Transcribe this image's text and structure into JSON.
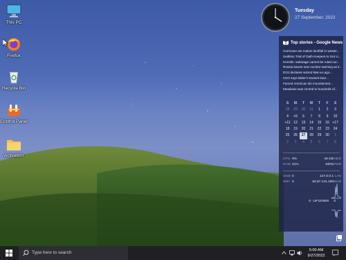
{
  "desktop": {
    "icons": [
      {
        "label": "This PC",
        "icon": "monitor-icon"
      },
      {
        "label": "Firefox",
        "icon": "firefox-icon"
      },
      {
        "label": "Recycle Bin",
        "icon": "recycle-bin-icon"
      },
      {
        "label": "Control Panel",
        "icon": "control-panel-icon"
      },
      {
        "label": "Activation",
        "icon": "folder-icon"
      }
    ]
  },
  "gadget": {
    "day": "Tuesday",
    "date": "27 September, 2022",
    "news_title": "Top stories - Google News",
    "news": [
      "Hurricane Ian makes landfall in wester...",
      "Sedition Trial of Oath Keepers to Get U...",
      "Kremlin: sabotage cannot be ruled out...",
      "Russia issues new nuclear warning as it...",
      "DOJ declares seized Mar-a-Lago...",
      "CEO says Biden't student loan...",
      "Famed American ski mountaineer...",
      "Meadows was central to hundreds of..."
    ],
    "calendar": {
      "headers": [
        "S",
        "M",
        "T",
        "W",
        "T",
        "F",
        "S"
      ],
      "rows": [
        [
          "28",
          "29",
          "30",
          "31",
          "1",
          "2",
          "3"
        ],
        [
          "4",
          "+5",
          "6",
          "7",
          "8",
          "9",
          "10"
        ],
        [
          "+11",
          "12",
          "13",
          "14",
          "15",
          "16",
          "+17"
        ],
        [
          "18",
          "19",
          "20",
          "21",
          "22",
          "23",
          "24"
        ],
        [
          "25",
          "26",
          "27",
          "28",
          "29",
          "30",
          "1"
        ],
        [
          "2",
          "3",
          "4",
          "5",
          "6",
          "7",
          "8"
        ]
      ],
      "muted_first_row": [
        0,
        1,
        2,
        3
      ],
      "today": "27"
    },
    "cpu_label": "CPU",
    "cpu_value": "0%",
    "ram_label": "RAM",
    "ram_value": "41%",
    "hdd_value": "49 GB",
    "hdd_label": "HDD",
    "pwr_value": "100%",
    "pwr_label": "PWR",
    "ssid_label": "SSID",
    "ssid_value": "0",
    "lan_value": "127.0.0.1",
    "lan_label": "LAN",
    "wifi_label": "WiFi",
    "wifi_value": "0",
    "wan_value": "50.67.141.198",
    "wan_label": "WAN",
    "up_value": "0",
    "up_label": "UP",
    "down_label": "DOWN",
    "down_value": "0"
  },
  "taskbar": {
    "search_placeholder": "Type here to search",
    "time": "5:00 AM",
    "date": "9/27/2022"
  }
}
